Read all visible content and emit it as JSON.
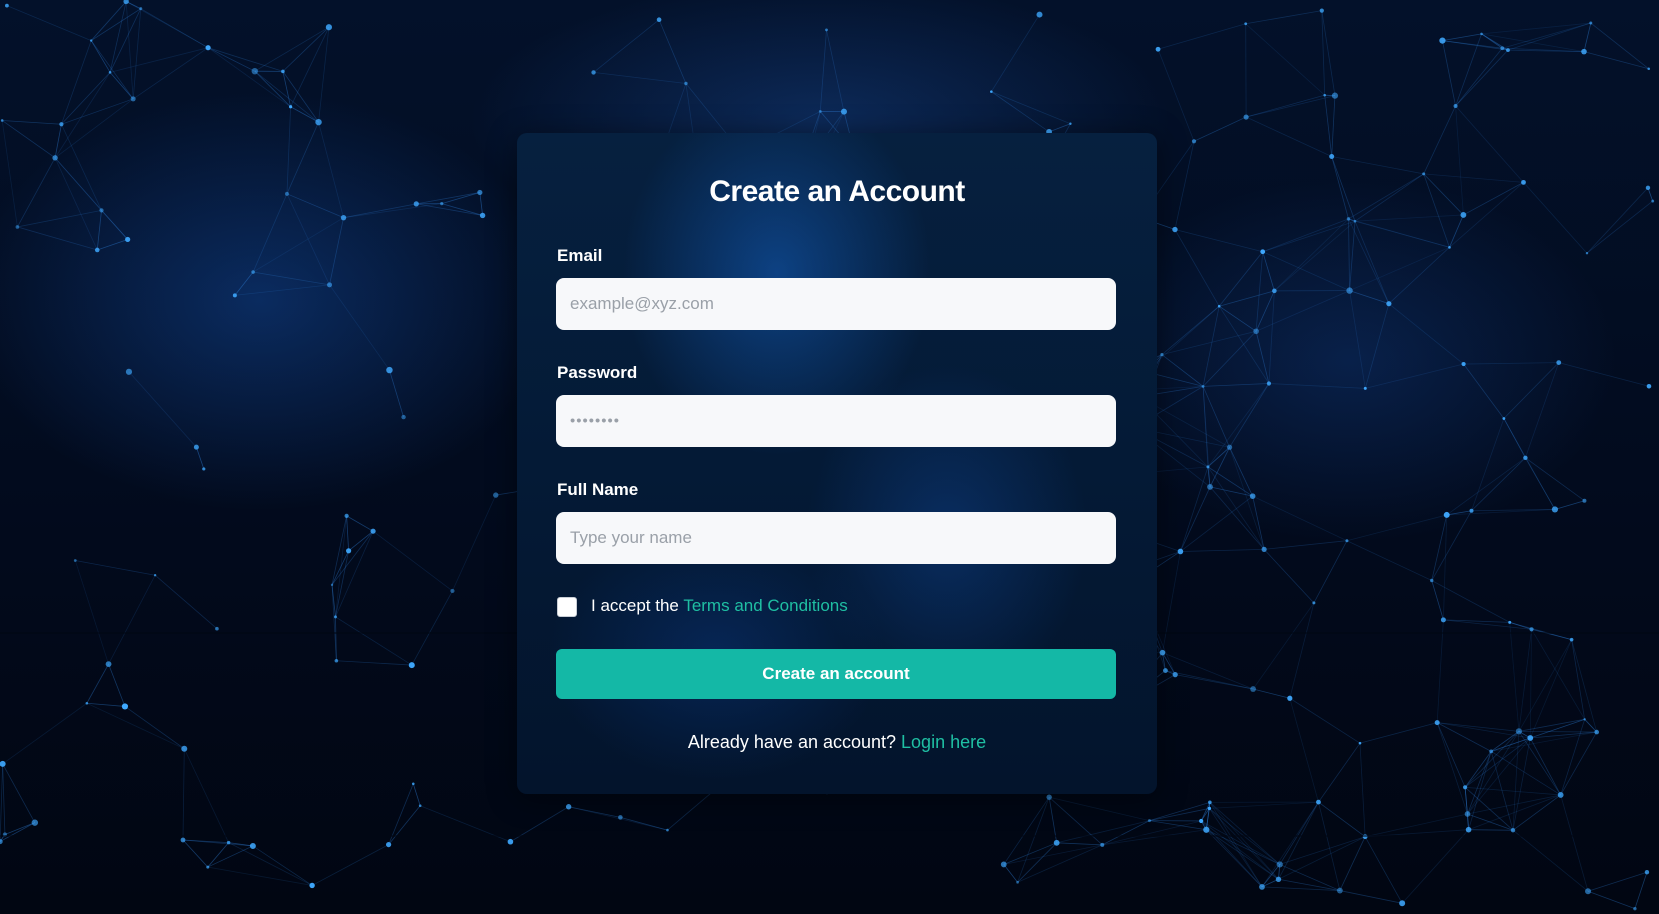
{
  "colors": {
    "accent": "#14b8a6",
    "link": "#1fbfa3",
    "card_bg": "#041a36",
    "input_bg": "#f7f8fa"
  },
  "form": {
    "title": "Create an Account",
    "email": {
      "label": "Email",
      "placeholder": "example@xyz.com",
      "value": ""
    },
    "password": {
      "label": "Password",
      "masked_value": "••••••••"
    },
    "full_name": {
      "label": "Full Name",
      "placeholder": "Type your name",
      "value": ""
    },
    "terms": {
      "checked": false,
      "prefix": "I accept the ",
      "link_text": "Terms and Conditions"
    },
    "submit_label": "Create an account",
    "login_prompt": {
      "text": "Already have an account? ",
      "link_text": "Login here"
    }
  }
}
